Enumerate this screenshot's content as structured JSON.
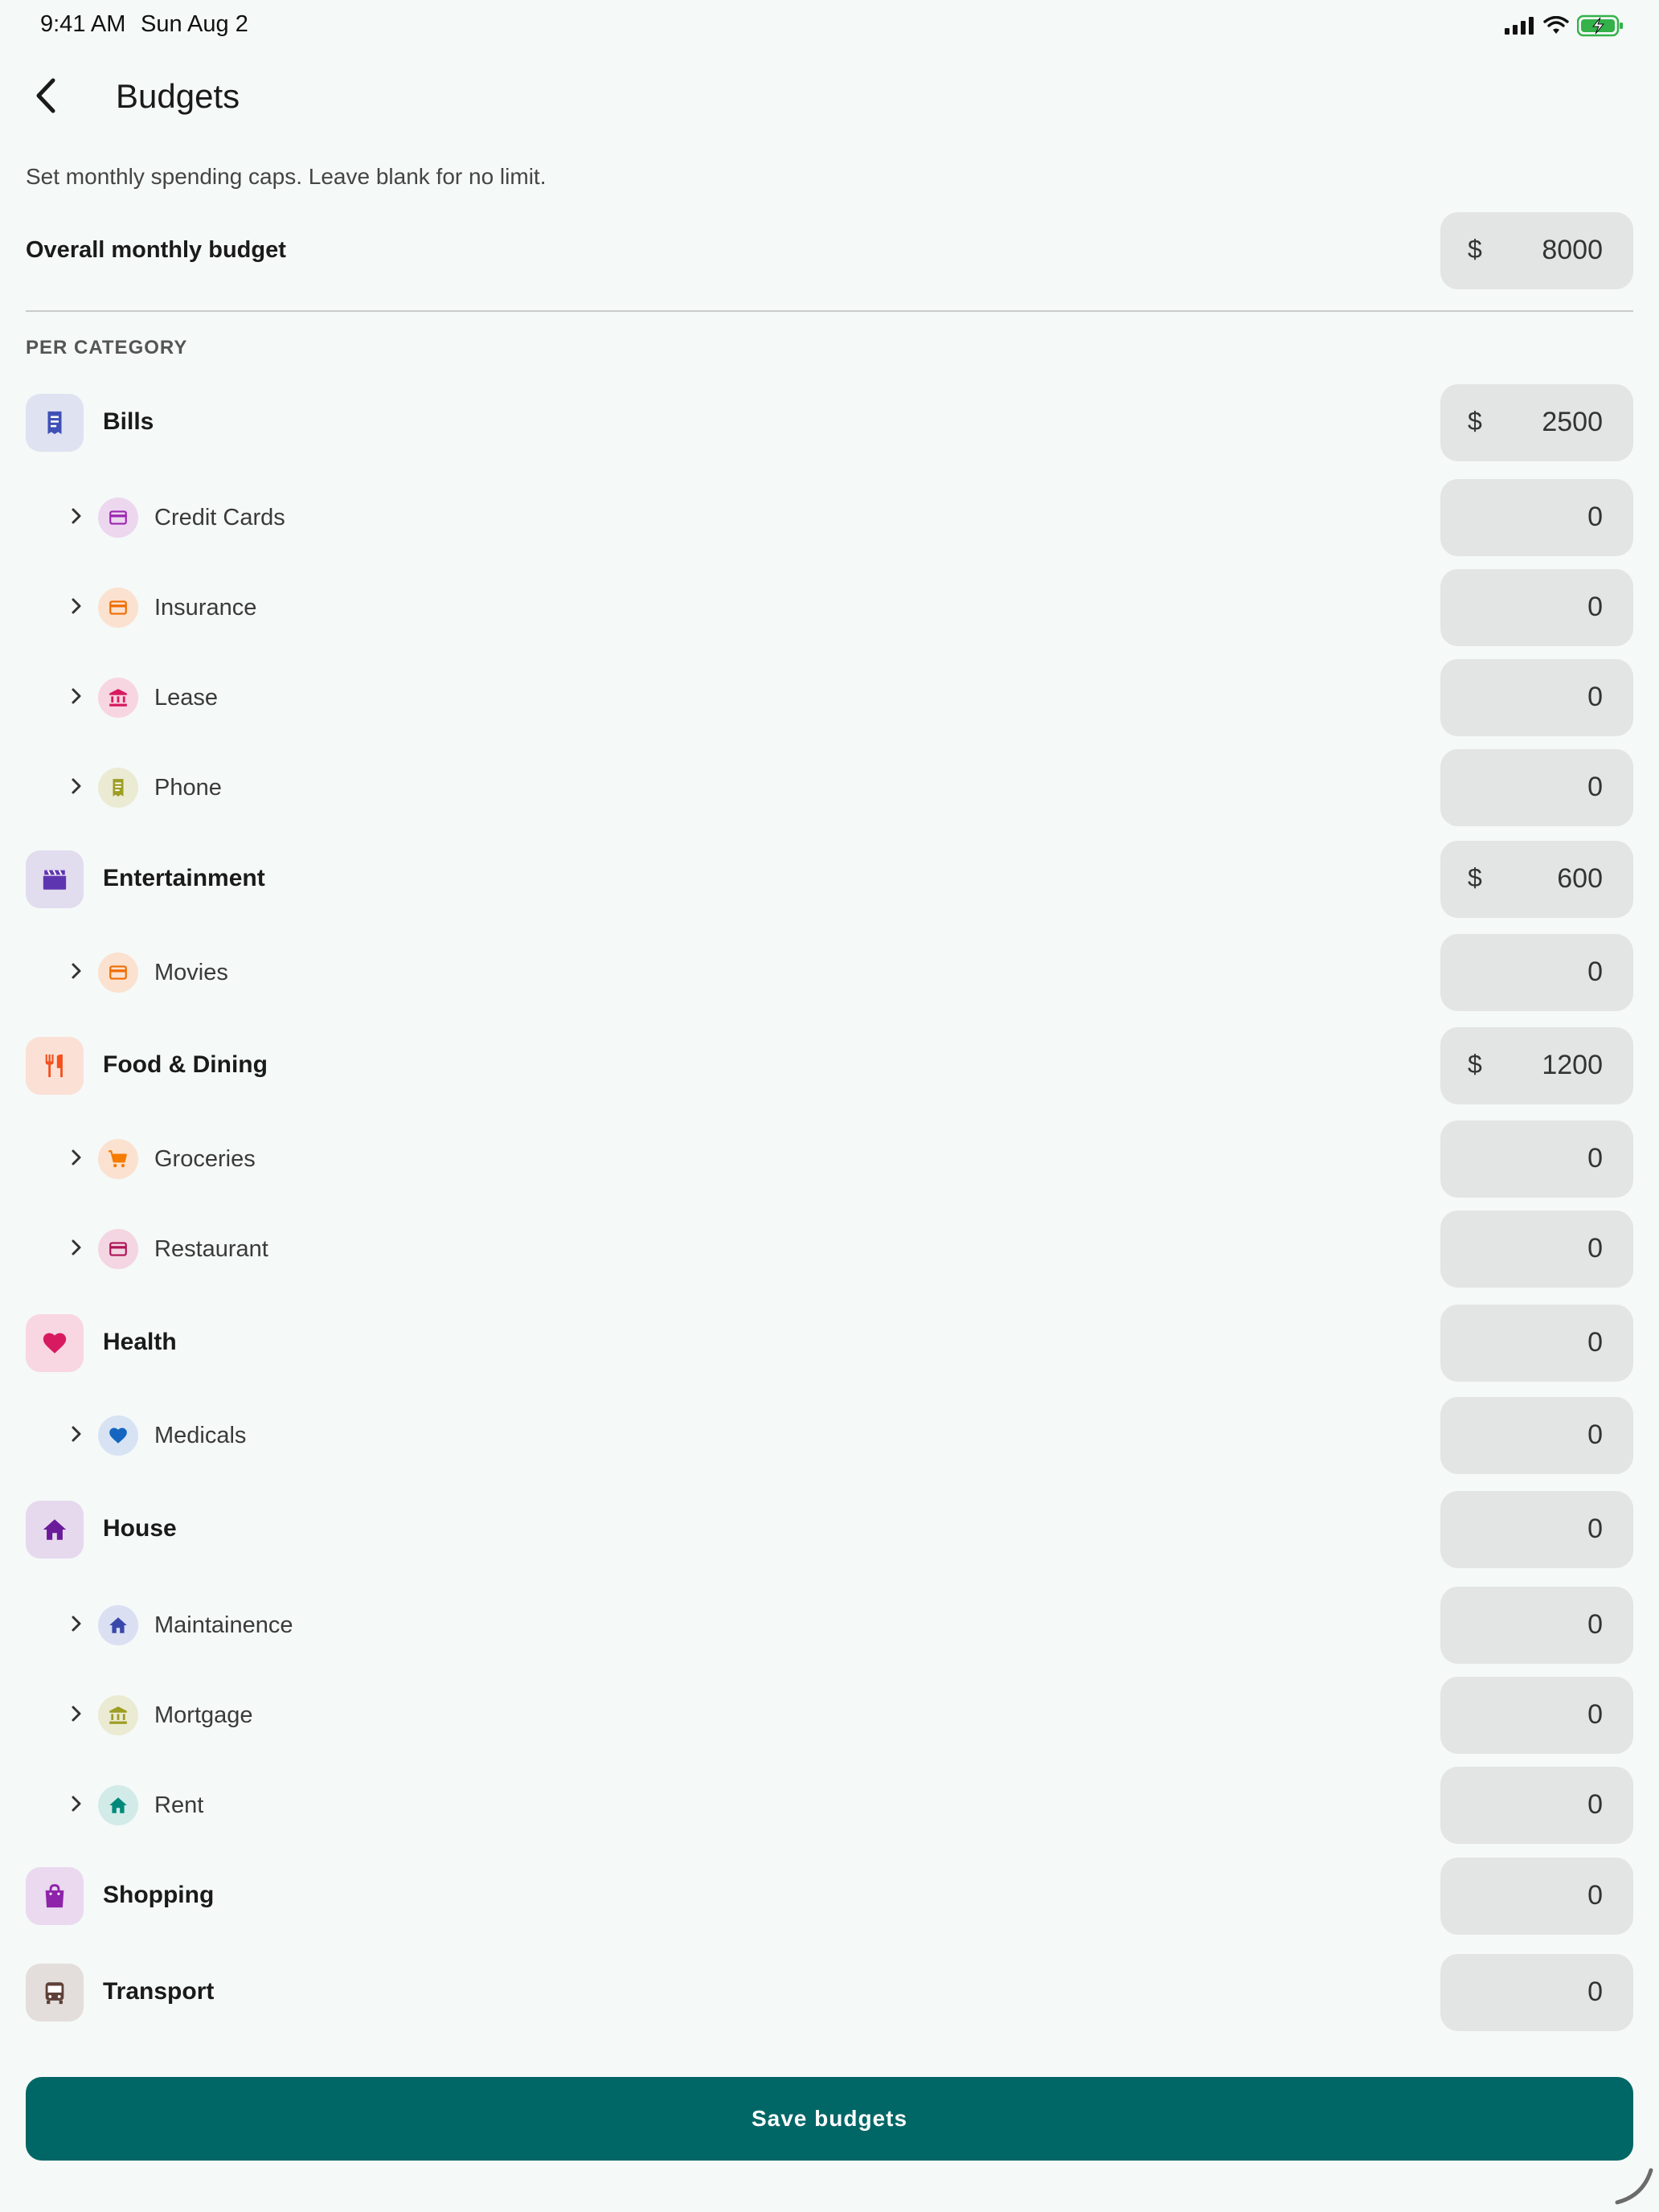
{
  "status": {
    "time": "9:41 AM",
    "date": "Sun Aug 2"
  },
  "appbar": {
    "title": "Budgets"
  },
  "subtitle": "Set monthly spending caps. Leave blank for no limit.",
  "overall": {
    "label": "Overall monthly budget",
    "currency": "$",
    "value": "8000"
  },
  "section_label": "PER CATEGORY",
  "rows": [
    {
      "type": "category",
      "label": "Bills",
      "icon": "receipt-icon",
      "color": "#3f51b5",
      "bg": "#dfe2f1",
      "currency": "$",
      "value": "2500"
    },
    {
      "type": "sub",
      "label": "Credit Cards",
      "icon": "credit-card-icon",
      "color": "#9c27b0",
      "bg": "#ecd7ef",
      "currency": "",
      "value": "0"
    },
    {
      "type": "sub",
      "label": "Insurance",
      "icon": "credit-card-icon",
      "color": "#ef6c00",
      "bg": "#fbe1cf",
      "currency": "",
      "value": "0"
    },
    {
      "type": "sub",
      "label": "Lease",
      "icon": "bank-icon",
      "color": "#d81b60",
      "bg": "#f7d6e1",
      "currency": "",
      "value": "0"
    },
    {
      "type": "sub",
      "label": "Phone",
      "icon": "receipt-icon",
      "color": "#9e9d24",
      "bg": "#ebebd3",
      "currency": "",
      "value": "0"
    },
    {
      "type": "category",
      "label": "Entertainment",
      "icon": "clapperboard-icon",
      "color": "#5e35b1",
      "bg": "#e2dcef",
      "currency": "$",
      "value": "600"
    },
    {
      "type": "sub",
      "label": "Movies",
      "icon": "credit-card-icon",
      "color": "#ef6c00",
      "bg": "#fbe1cf",
      "currency": "",
      "value": "0"
    },
    {
      "type": "category",
      "label": "Food & Dining",
      "icon": "restaurant-icon",
      "color": "#f4511e",
      "bg": "#fbe0d6",
      "currency": "$",
      "value": "1200"
    },
    {
      "type": "sub",
      "label": "Groceries",
      "icon": "cart-icon",
      "color": "#f57c00",
      "bg": "#fbe1cf",
      "currency": "",
      "value": "0"
    },
    {
      "type": "sub",
      "label": "Restaurant",
      "icon": "credit-card-icon",
      "color": "#ad1457",
      "bg": "#f3d6e1",
      "currency": "",
      "value": "0"
    },
    {
      "type": "category",
      "label": "Health",
      "icon": "heart-icon",
      "color": "#d81b60",
      "bg": "#f8d7e2",
      "currency": "",
      "value": "0"
    },
    {
      "type": "sub",
      "label": "Medicals",
      "icon": "heart-icon",
      "color": "#1565c0",
      "bg": "#d7e3f3",
      "currency": "",
      "value": "0"
    },
    {
      "type": "category",
      "label": "House",
      "icon": "home-icon",
      "color": "#6a1b9a",
      "bg": "#e6d9ee",
      "currency": "",
      "value": "0"
    },
    {
      "type": "sub",
      "label": "Maintainence",
      "icon": "home-icon",
      "color": "#3949ab",
      "bg": "#dadff1",
      "currency": "",
      "value": "0"
    },
    {
      "type": "sub",
      "label": "Mortgage",
      "icon": "bank-icon",
      "color": "#9e9d24",
      "bg": "#ebebd3",
      "currency": "",
      "value": "0"
    },
    {
      "type": "sub",
      "label": "Rent",
      "icon": "home-icon",
      "color": "#00897b",
      "bg": "#d3ebe8",
      "currency": "",
      "value": "0"
    },
    {
      "type": "category",
      "label": "Shopping",
      "icon": "shopping-bag-icon",
      "color": "#8e24aa",
      "bg": "#ead9ef",
      "currency": "",
      "value": "0"
    },
    {
      "type": "category",
      "label": "Transport",
      "icon": "bus-icon",
      "color": "#5d4037",
      "bg": "#e3dedc",
      "currency": "",
      "value": "0"
    }
  ],
  "save_button": {
    "label": "Save budgets",
    "color": "#016666"
  }
}
